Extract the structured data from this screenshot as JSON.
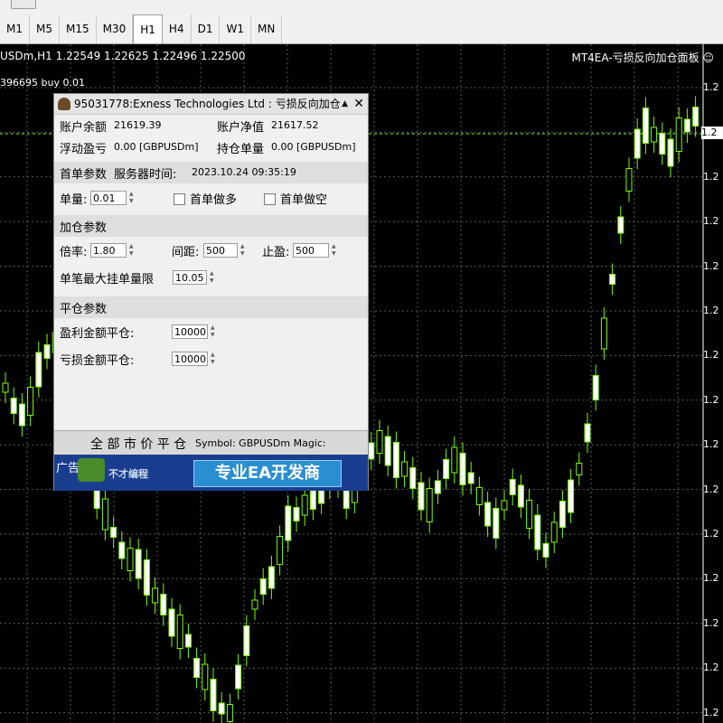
{
  "toolbar": {
    "timeframes": [
      "M1",
      "M5",
      "M15",
      "M30",
      "H1",
      "H4",
      "D1",
      "W1",
      "MN"
    ],
    "active_timeframe": "H1"
  },
  "chart": {
    "symbol_info": "USDm,H1  1.22549 1.22625 1.22496 1.22500",
    "ea_name": "MT4EA-亏损反向加仓面板 ☺",
    "order_label": "396695 buy 0.01",
    "price_labels": [
      "1.2",
      "1.2",
      "1.2",
      "1.2",
      "1.2",
      "1.2",
      "1.2",
      "1.2",
      "1.2",
      "1.2",
      "1.2",
      "1.2",
      "1.2",
      "1.2",
      "1.2"
    ],
    "current_price_label": "1.2",
    "colors": {
      "background": "#000000",
      "candle": "#7CFC00",
      "bull_body": "#000000",
      "bear_body": "#ffffff",
      "grid": "#5a5a5a"
    }
  },
  "panel": {
    "title": "95031778:Exness Technologies Ltd : 亏损反向加仓",
    "min_icon": "▲",
    "close_icon": "✕",
    "balance_label": "账户余额",
    "balance_value": "21619.39",
    "equity_label": "账户净值",
    "equity_value": "21617.52",
    "float_label": "浮动盈亏",
    "float_value": "0.00  [GBPUSDm]",
    "lots_label": "持仓单量",
    "lots_value": "0.00  [GBPUSDm]",
    "first_order_section": "首单参数",
    "server_time_label": "服务器时间:",
    "server_time_value": "2023.10.24 09:35:19",
    "lot_label": "单量:",
    "lot_value": "0.01",
    "first_buy_label": "首单做多",
    "first_sell_label": "首单做空",
    "add_section": "加仓参数",
    "multiplier_label": "倍率:",
    "multiplier_value": "1.80",
    "distance_label": "间距:",
    "distance_value": "500",
    "tp_label": "止盈:",
    "tp_value": "500",
    "max_lot_label": "单笔最大挂单量限",
    "max_lot_value": "10.05",
    "close_section": "平仓参数",
    "profit_close_label": "盈利金额平仓:",
    "profit_close_value": "10000",
    "loss_close_label": "亏损金额平仓:",
    "loss_close_value": "10000",
    "close_all_button": "全 部 市 价 平 仓",
    "symbol_text": "Symbol:  GBPUSDm  Magic:",
    "ad_label": "广告",
    "ad_brand": "不才编程",
    "ad_slogan": "专业EA开发商"
  }
}
